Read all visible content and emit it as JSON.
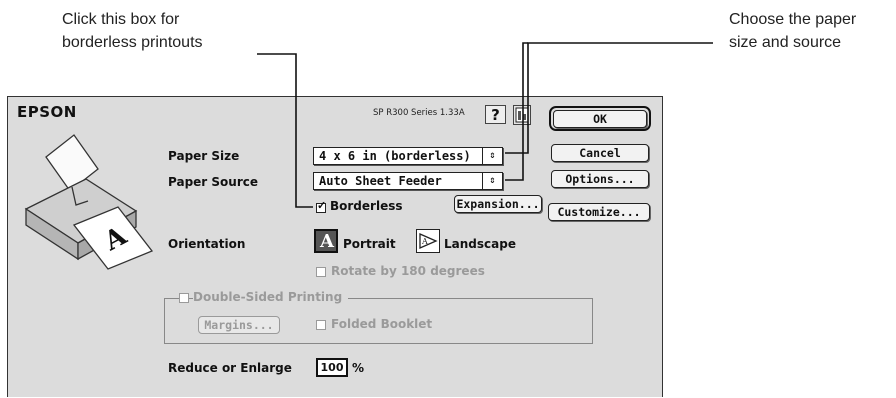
{
  "callouts": {
    "left": {
      "line1": "Click this box for",
      "line2": "borderless printouts"
    },
    "right": {
      "line1": "Choose the paper",
      "line2": "size and source"
    }
  },
  "dialog": {
    "brand": "EPSON",
    "version": "SP R300 Series 1.33A",
    "help_label": "?"
  },
  "paper_size": {
    "label": "Paper Size",
    "value": "4 x 6 in (borderless)"
  },
  "paper_source": {
    "label": "Paper Source",
    "value": "Auto Sheet Feeder"
  },
  "borderless": {
    "label": "Borderless",
    "checked": true,
    "mark": "✓"
  },
  "buttons": {
    "ok": "OK",
    "cancel": "Cancel",
    "options": "Options...",
    "expansion": "Expansion...",
    "customize": "Customize..."
  },
  "orientation": {
    "label": "Orientation",
    "portrait": "Portrait",
    "landscape": "Landscape",
    "portrait_glyph": "A",
    "rotate": "Rotate by 180 degrees"
  },
  "double_sided": {
    "label": "Double-Sided Printing",
    "margins": "Margins...",
    "folded": "Folded Booklet"
  },
  "reduce": {
    "label": "Reduce or Enlarge",
    "value": "100",
    "unit": "%"
  }
}
